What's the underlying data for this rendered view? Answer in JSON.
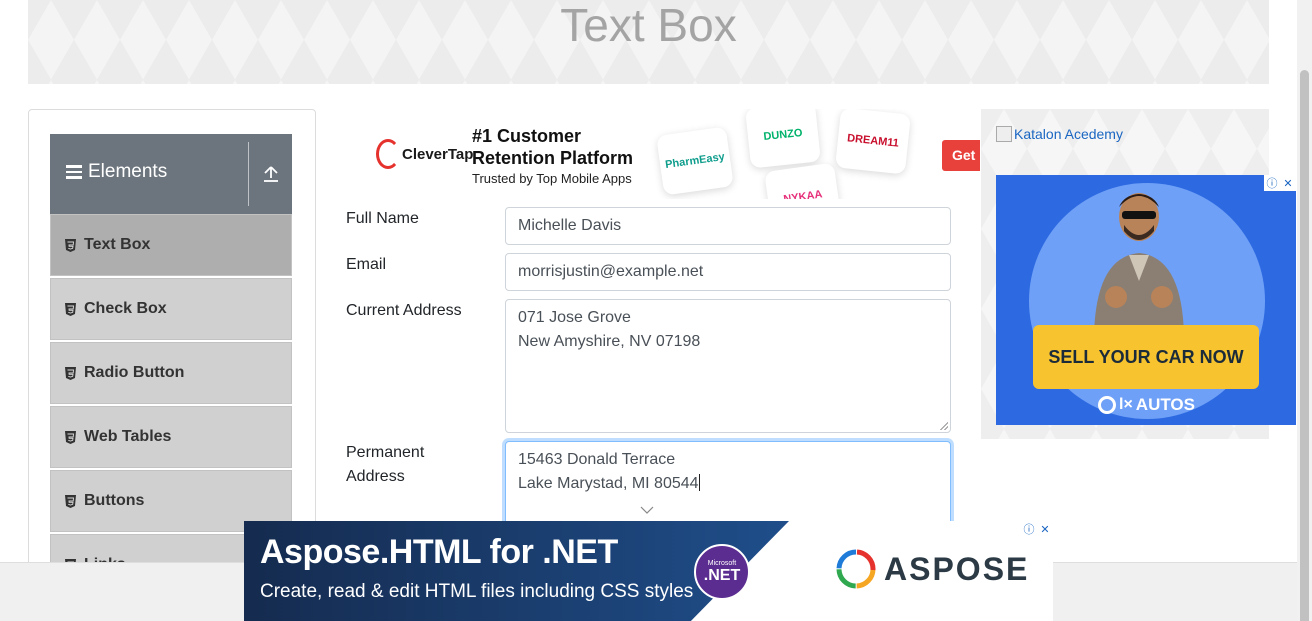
{
  "header": {
    "title": "Text Box"
  },
  "sidebar": {
    "group_title": "Elements",
    "items": [
      {
        "label": "Text Box",
        "active": true
      },
      {
        "label": "Check Box"
      },
      {
        "label": "Radio Button"
      },
      {
        "label": "Web Tables"
      },
      {
        "label": "Buttons"
      },
      {
        "label": "Links"
      }
    ]
  },
  "ad_top": {
    "brand": "CleverTap",
    "headline_line1": "#1 Customer",
    "headline_line2": "Retention Platform",
    "sub": "Trusted by Top Mobile Apps",
    "tiles": [
      "PharmEasy",
      "DUNZO",
      "DREAM11",
      "NYKAA"
    ],
    "cta": "Get"
  },
  "form": {
    "full_name": {
      "label": "Full Name",
      "value": "Michelle Davis"
    },
    "email": {
      "label": "Email",
      "value": "morrisjustin@example.net"
    },
    "current_address": {
      "label": "Current Address",
      "line1": "071 Jose Grove",
      "line2": "New Amyshire, NV 07198"
    },
    "permanent_address": {
      "label_line1": "Permanent",
      "label_line2": "Address",
      "line1": "15463 Donald Terrace",
      "line2": "Lake Marystad, MI 80544"
    }
  },
  "ad_right": {
    "image_alt": "Katalon Acedemy",
    "cta": "SELL YOUR CAR NOW",
    "brand": "AUTOS",
    "brand_mark": "OLX"
  },
  "ad_bottom": {
    "title": "Aspose.HTML for .NET",
    "sub": "Create, read & edit HTML files including CSS styles",
    "badge_small": "Microsoft",
    "badge_big": ".NET",
    "logo": "ASPOSE"
  },
  "colors": {
    "sidebar_header": "#6c757d",
    "menu_item": "#d0d0d0",
    "menu_active": "#aeaeae",
    "focus_ring": "#80bdff",
    "olx_blue": "#2d6ae2",
    "olx_yellow": "#f7c32e",
    "clevertap_red": "#e8413c"
  }
}
